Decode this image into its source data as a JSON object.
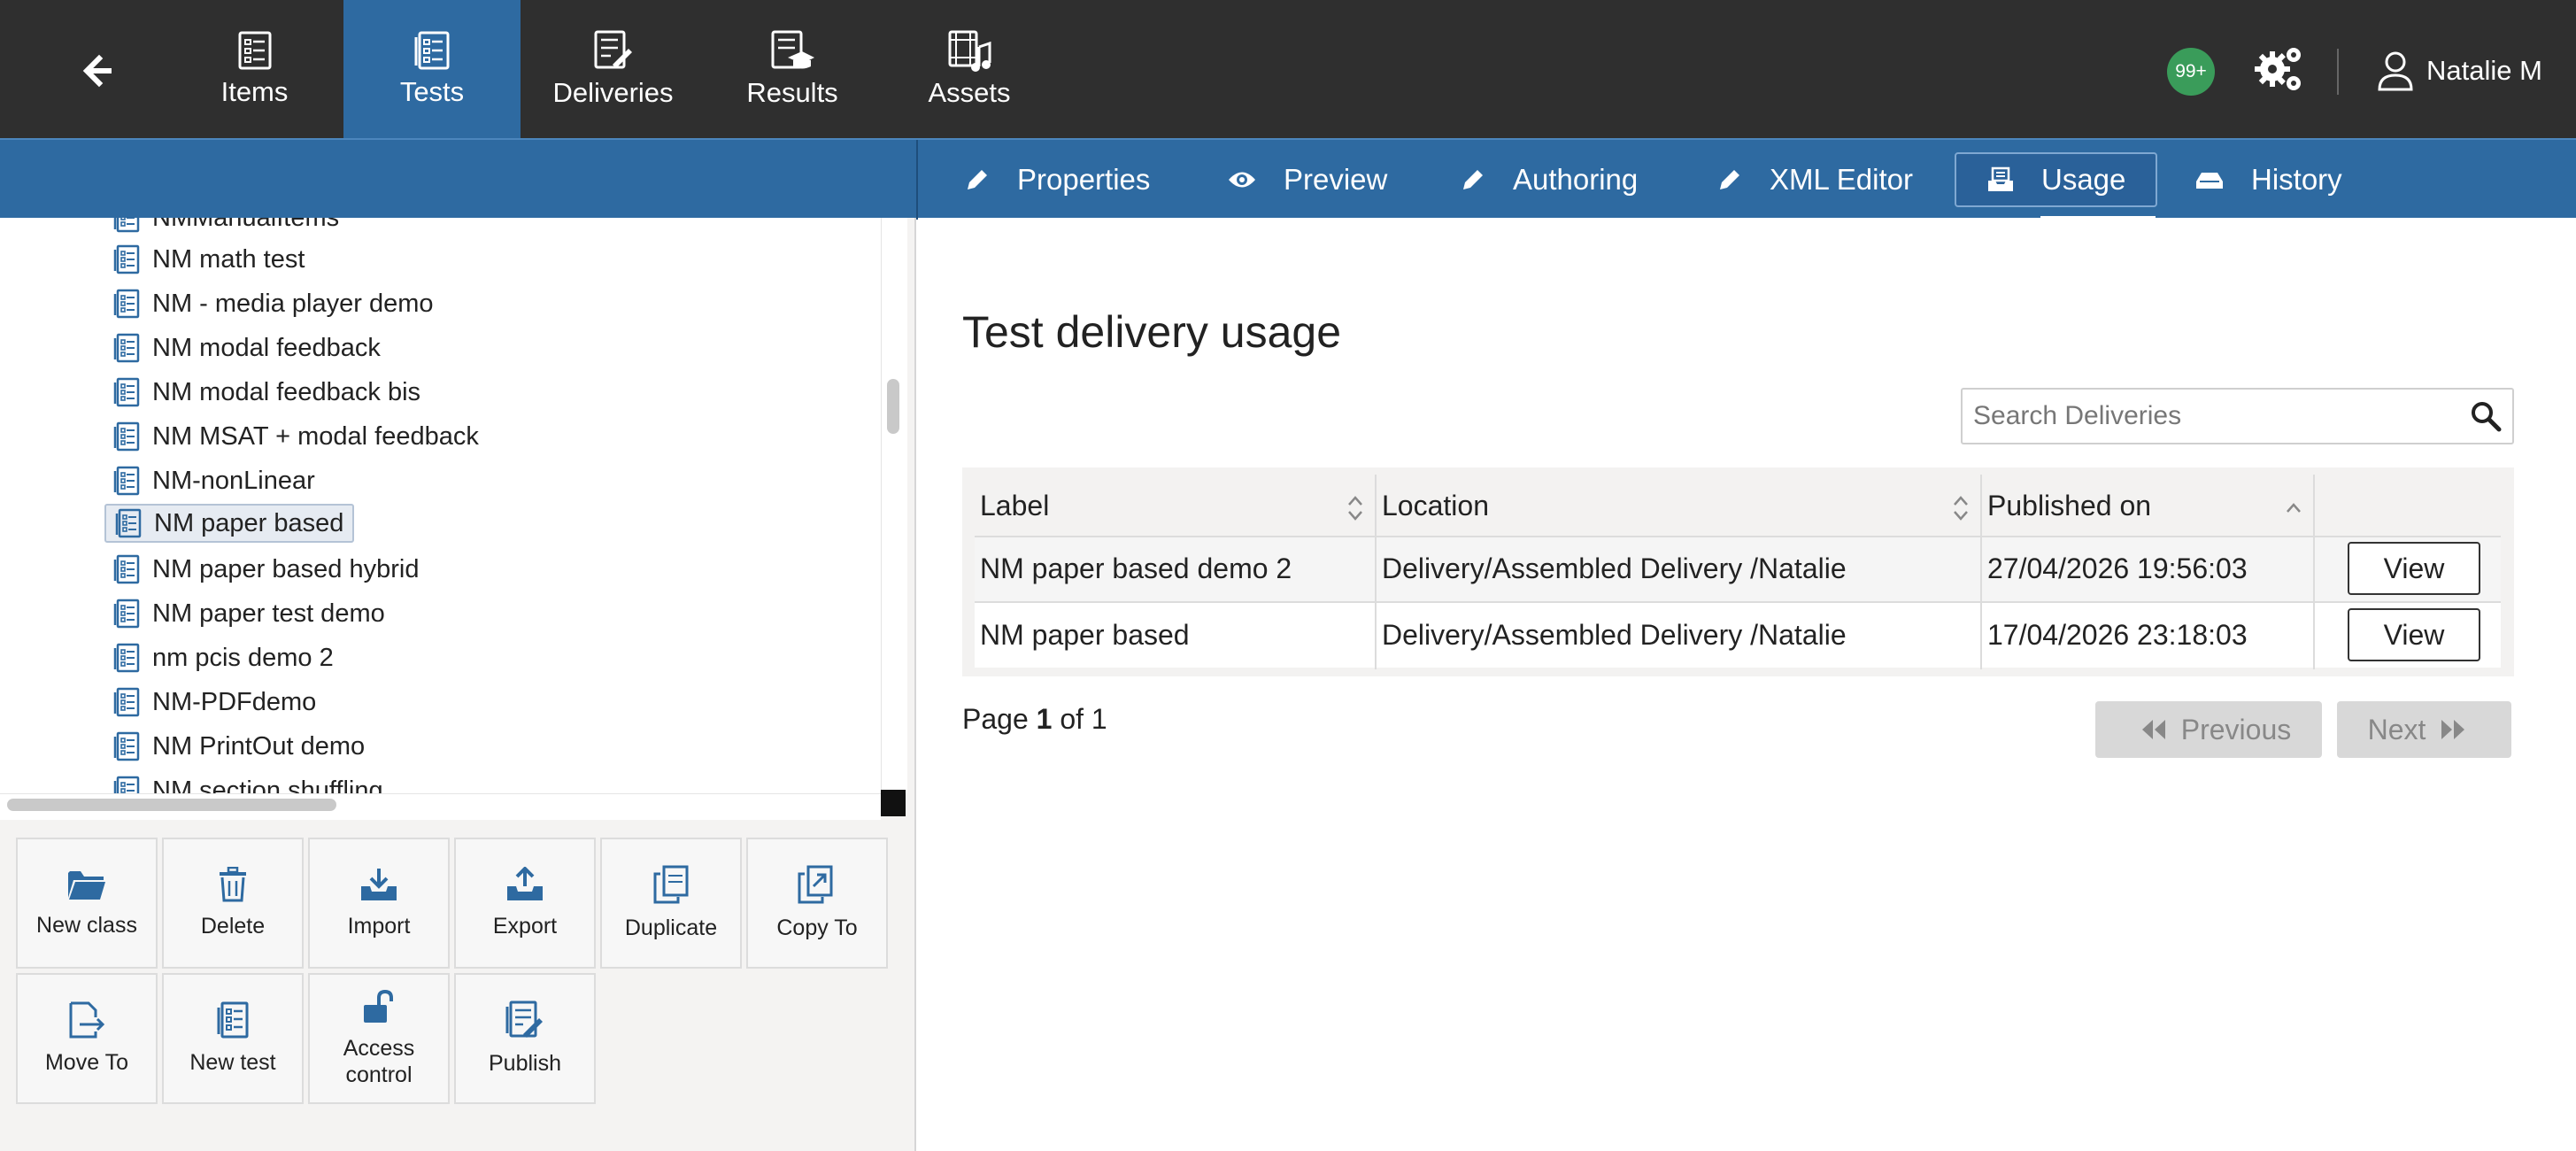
{
  "topnav": {
    "tabs": [
      {
        "label": "Items"
      },
      {
        "label": "Tests"
      },
      {
        "label": "Deliveries"
      },
      {
        "label": "Results"
      },
      {
        "label": "Assets"
      }
    ],
    "active_tab": "Tests",
    "notification_count": "99+",
    "user_name": "Natalie M"
  },
  "actionbar": {
    "tabs": [
      {
        "label": "Properties",
        "icon": "pencil-icon"
      },
      {
        "label": "Preview",
        "icon": "eye-icon"
      },
      {
        "label": "Authoring",
        "icon": "pencil-icon"
      },
      {
        "label": "XML Editor",
        "icon": "pencil-icon"
      },
      {
        "label": "Usage",
        "icon": "tray-icon"
      },
      {
        "label": "History",
        "icon": "history-icon"
      }
    ],
    "active_tab": "Usage"
  },
  "tree": {
    "items": [
      {
        "label": "NMManualItems"
      },
      {
        "label": "NM math test"
      },
      {
        "label": "NM - media player demo"
      },
      {
        "label": "NM modal feedback"
      },
      {
        "label": "NM modal feedback bis"
      },
      {
        "label": "NM MSAT + modal feedback"
      },
      {
        "label": "NM-nonLinear"
      },
      {
        "label": "NM paper based"
      },
      {
        "label": "NM paper based hybrid"
      },
      {
        "label": "NM paper test demo"
      },
      {
        "label": "nm pcis demo 2"
      },
      {
        "label": "NM-PDFdemo"
      },
      {
        "label": "NM PrintOut demo"
      },
      {
        "label": "NM section shuffling"
      }
    ],
    "selected": "NM paper based"
  },
  "actions": {
    "buttons": [
      {
        "label": "New class",
        "icon": "folder-open-icon"
      },
      {
        "label": "Delete",
        "icon": "trash-icon"
      },
      {
        "label": "Import",
        "icon": "import-icon"
      },
      {
        "label": "Export",
        "icon": "export-icon"
      },
      {
        "label": "Duplicate",
        "icon": "duplicate-icon"
      },
      {
        "label": "Copy To",
        "icon": "copy-to-icon"
      },
      {
        "label": "Move To",
        "icon": "move-to-icon"
      },
      {
        "label": "New test",
        "icon": "test-icon"
      },
      {
        "label": "Access control",
        "icon": "unlock-icon"
      },
      {
        "label": "Publish",
        "icon": "publish-icon"
      }
    ]
  },
  "main": {
    "title": "Test delivery usage",
    "search_placeholder": "Search Deliveries",
    "table": {
      "columns": [
        "Label",
        "Location",
        "Published on"
      ],
      "rows": [
        {
          "label": "NM paper based demo 2",
          "location": "Delivery/Assembled Delivery /Natalie",
          "published_on": "27/04/2026 19:56:03",
          "action": "View"
        },
        {
          "label": "NM paper based",
          "location": "Delivery/Assembled Delivery /Natalie",
          "published_on": "17/04/2026 23:18:03",
          "action": "View"
        }
      ]
    },
    "pagination": {
      "page_prefix": "Page",
      "current": "1",
      "of_label": "of",
      "total": "1",
      "previous_label": "Previous",
      "next_label": "Next"
    }
  },
  "colors": {
    "topbar_bg": "#2f2f2f",
    "accent_blue": "#2e6aa1",
    "badge_green": "#3a9c5a"
  }
}
